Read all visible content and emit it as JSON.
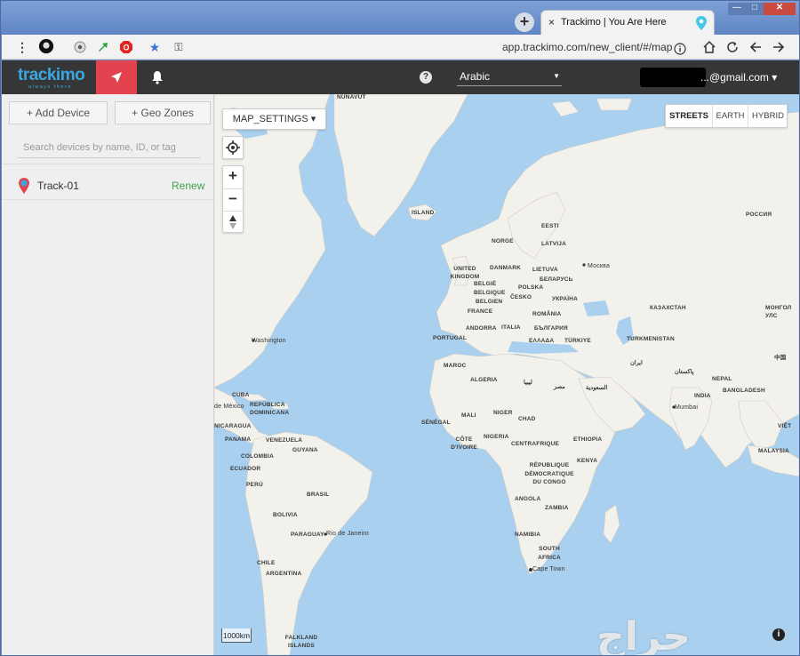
{
  "browser": {
    "new_tab_icon": "plus-icon",
    "tab_title": "Trackimo | You Are Here",
    "tab_close": "×",
    "window_controls": {
      "minimize": "—",
      "maximize": "□",
      "close": "✕"
    },
    "url": "app.trackimo.com/new_client/#/map"
  },
  "header": {
    "logo_text": "trackimo",
    "logo_subtext": "always there",
    "help_symbol": "?",
    "language": "Arabic",
    "email": "...@gmail.com ▾",
    "accent_color": "#e3434f"
  },
  "sidebar": {
    "add_device": "+ Add Device",
    "geo_zones": "+ Geo Zones",
    "search_placeholder": "Search devices by name, ID, or tag",
    "devices": [
      {
        "name": "Track-01",
        "action": "Renew"
      }
    ]
  },
  "map": {
    "settings_label": "MAP_SETTINGS ▾",
    "zoom_in": "+",
    "zoom_out": "−",
    "view_modes": [
      "STREETS",
      "EARTH",
      "HYBRID"
    ],
    "active_view": "STREETS",
    "scale": "1000km",
    "info_symbol": "i",
    "watermark": "حراج",
    "labels": {
      "nunavut": "NUNAVUT",
      "island": "ISLAND",
      "rossiya": "РОССИЯ",
      "norge": "NORGE",
      "eesti": "EESTI",
      "latvija": "LATVIJA",
      "lietuva": "LIETUVA",
      "danmark": "DANMARK",
      "moskva": "Москва",
      "united_kingdom": "UNITED KINGDOM",
      "belgie": "BELGIË",
      "belgique": "BELGIQUE",
      "belgien": "BELGIEN",
      "france": "FRANCE",
      "polska": "POLSKA",
      "cesko": "ČESKO",
      "belarus": "БЕЛАРУСЬ",
      "ukraina": "УКРАЇНА",
      "romania": "ROMÂNIA",
      "bulgaria": "БЪЛГАРИЯ",
      "kazakhstan": "КАЗАХСТАН",
      "mongol": "МОНГОЛ УЛС",
      "portugal": "PORTUGAL",
      "andorra": "ANDORRA",
      "italia": "ITALIA",
      "ellada": "ΕΛΛΑΔΑ",
      "turkiye": "TÜRKIYE",
      "turkmenistan": "TURKMENISTAN",
      "china": "中国",
      "washington": "Washington",
      "maroc": "MAROC",
      "algeria": "ALGERIA",
      "libya": "ليبيا",
      "egypt": "مصر",
      "saudi": "السعودية",
      "iran": "ایران",
      "pakistan": "پاکستان",
      "india": "INDIA",
      "nepal": "NEPAL",
      "bangladesh": "BANGLADESH",
      "mumbai": "Mumbai",
      "mali": "MALI",
      "niger": "NIGER",
      "chad": "CHAD",
      "senegal": "SÉNÉGAL",
      "nigeria": "NIGERIA",
      "cote": "CÔTE D'IVOIRE",
      "centrafrique": "CENTRAFRIQUE",
      "ethiopia": "ETHIOPIA",
      "kenya": "KENYA",
      "rdc": "RÉPUBLIQUE DÉMOCRATIQUE DU CONGO",
      "angola": "ANGOLA",
      "zambia": "ZAMBIA",
      "namibia": "NAMIBIA",
      "south_africa": "SOUTH AFRICA",
      "cape_town": "Cape Town",
      "cuba": "CUBA",
      "mexico": "de México",
      "dominicana": "REPÚBLICA DOMINICANA",
      "nicaragua": "NICARAGUA",
      "panama": "PANAMA",
      "venezuela": "VENEZUELA",
      "guyana": "GUYANA",
      "colombia": "COLOMBIA",
      "ecuador": "ECUADOR",
      "peru": "PERÚ",
      "brasil": "BRASIL",
      "bolivia": "BOLIVIA",
      "paraguay": "PARAGUAY",
      "rio": "Rio de Janeiro",
      "chile": "CHILE",
      "argentina": "ARGENTINA",
      "falkland": "FALKLAND ISLANDS",
      "malaysia": "MALAYSIA",
      "viet": "VIỆT"
    }
  }
}
